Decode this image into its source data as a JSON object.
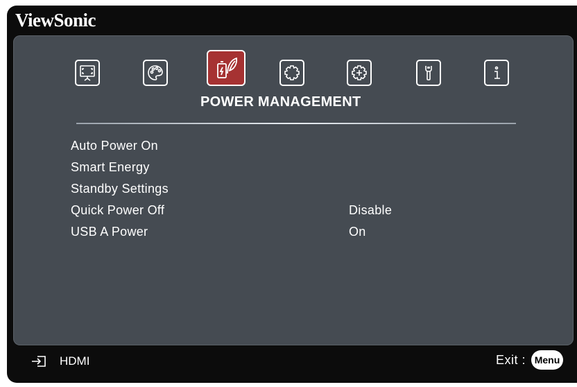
{
  "brand": "ViewSonic",
  "tabs": [
    {
      "name": "display-icon"
    },
    {
      "name": "image-setting-icon"
    },
    {
      "name": "power-management-icon",
      "active": true
    },
    {
      "name": "basic-settings-icon"
    },
    {
      "name": "advanced-settings-icon"
    },
    {
      "name": "tools-icon"
    },
    {
      "name": "information-icon"
    }
  ],
  "menu_title": "POWER MANAGEMENT",
  "items": [
    {
      "label": "Auto Power On",
      "value": ""
    },
    {
      "label": "Smart Energy",
      "value": ""
    },
    {
      "label": "Standby Settings",
      "value": ""
    },
    {
      "label": "Quick Power Off",
      "value": "Disable"
    },
    {
      "label": "USB A Power",
      "value": "On"
    }
  ],
  "footer": {
    "source_icon": "input-source-icon",
    "source_label": "HDMI",
    "exit_label": "Exit :",
    "menu_button": "Menu"
  },
  "colors": {
    "frame": "#0c0c0c",
    "panel": "#454b52",
    "active_tab": "#a63232",
    "text": "#ffffff"
  }
}
